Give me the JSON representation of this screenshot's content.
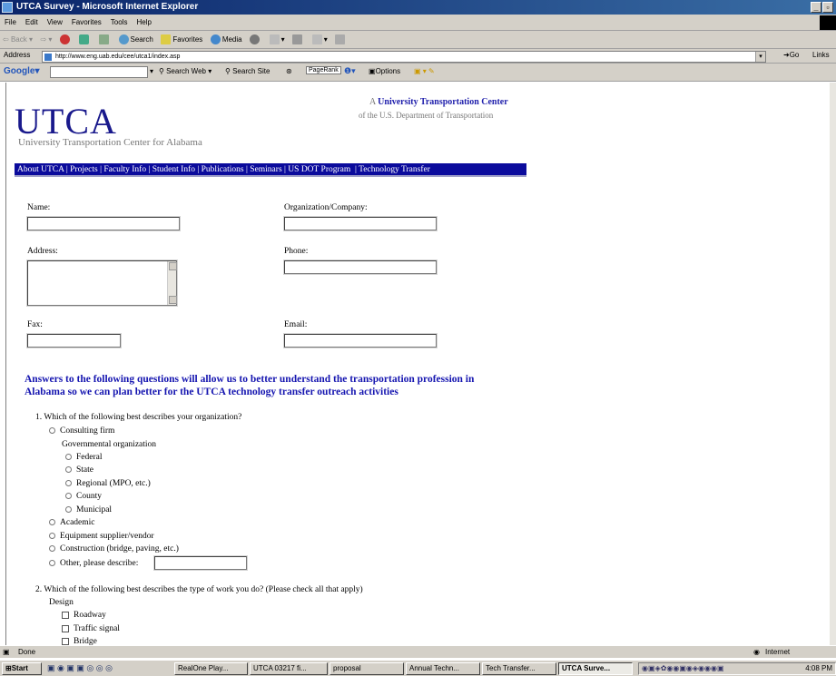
{
  "window": {
    "title": "UTCA Survey - Microsoft Internet Explorer"
  },
  "menu": [
    "File",
    "Edit",
    "View",
    "Favorites",
    "Tools",
    "Help"
  ],
  "toolbar": {
    "back": "Back",
    "search": "Search",
    "favorites": "Favorites",
    "media": "Media"
  },
  "address": {
    "label": "Address",
    "url": "http://www.eng.uab.edu/cee/utca1/index.asp",
    "go": "Go",
    "links": "Links"
  },
  "google": {
    "label": "Google",
    "search_web": "Search Web",
    "search_site": "Search Site",
    "pagerank": "PageRank",
    "options": "Options"
  },
  "page": {
    "logo": "UTCA",
    "logo_sub": "University Transportation Center for Alabama",
    "ut_prefix": "A",
    "ut_name": "University Transportation Center",
    "ut_sub": "of the U.S. Department of Transportation",
    "nav": [
      "About UTCA",
      "Projects",
      "Faculty Info",
      "Student Info",
      "Publications",
      "Seminars",
      "US DOT Program",
      "Technology Transfer"
    ],
    "form": {
      "name": "Name:",
      "org": "Organization/Company:",
      "address": "Address:",
      "phone": "Phone:",
      "fax": "Fax:",
      "email": "Email:"
    },
    "intro": "Answers to the following questions will allow us to better understand the transportation profession in Alabama so we can plan better for the UTCA technology transfer outreach activities",
    "q1": {
      "text": "1. Which of the following best describes your organization?",
      "consulting": "Consulting firm",
      "gov_header": "Governmental organization",
      "gov": [
        "Federal",
        "State",
        "Regional (MPO, etc.)",
        "County",
        "Municipal"
      ],
      "others": [
        "Academic",
        "Equipment supplier/vendor",
        "Construction (bridge, paving, etc.)"
      ],
      "other_describe": "Other, please describe:"
    },
    "q2": {
      "text": "2. Which of the following best describes the type of work you do?  (Please check all that apply)",
      "design_header": "Design",
      "design": [
        "Roadway",
        "Traffic signal",
        "Bridge"
      ]
    }
  },
  "status": {
    "text": "Done",
    "zone": "Internet"
  },
  "taskbar": {
    "start": "Start",
    "tasks": [
      "RealOne Play...",
      "UTCA 03217 fi...",
      "proposal",
      "Annual Techn...",
      "Tech Transfer...",
      "UTCA Surve..."
    ],
    "clock": "4:08 PM"
  }
}
